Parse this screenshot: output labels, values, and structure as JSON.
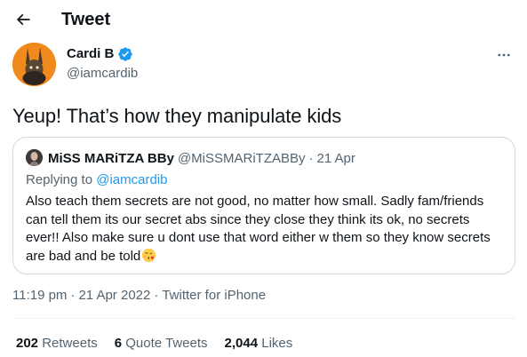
{
  "header": {
    "title": "Tweet",
    "back_icon": "arrow-left-icon"
  },
  "tweet": {
    "author": {
      "display_name": "Cardi B",
      "handle": "@iamcardib",
      "verified": true,
      "verified_color": "#1d9bf0"
    },
    "text": "Yeup! That’s how they manipulate kids",
    "quote": {
      "author": {
        "display_name": "MiSS MARiTZA BBy",
        "handle": "@MiSSMARiTZABBy",
        "separator": "·",
        "date": "21 Apr"
      },
      "reply_prefix": "Replying to",
      "reply_to": "@iamcardib",
      "text": "Also teach them secrets are not good, no matter how small. Sadly fam/friends can tell them its our secret abs since they close they think its ok, no secrets ever!! Also make sure u dont use that word either w them so they know secrets are bad and be told",
      "emoji": "face-blowing-kiss"
    },
    "meta": {
      "time": "11:19 pm",
      "separator": "·",
      "date": "21 Apr 2022",
      "source": "Twitter for iPhone"
    },
    "stats": {
      "retweets": {
        "count": "202",
        "label": "Retweets"
      },
      "quote_tweets": {
        "count": "6",
        "label": "Quote Tweets"
      },
      "likes": {
        "count": "2,044",
        "label": "Likes"
      }
    }
  },
  "colors": {
    "text": "#0f1419",
    "secondary": "#536471",
    "link": "#1d9bf0",
    "border": "#cfd9de",
    "avatar_bg": "#f08a1c"
  }
}
